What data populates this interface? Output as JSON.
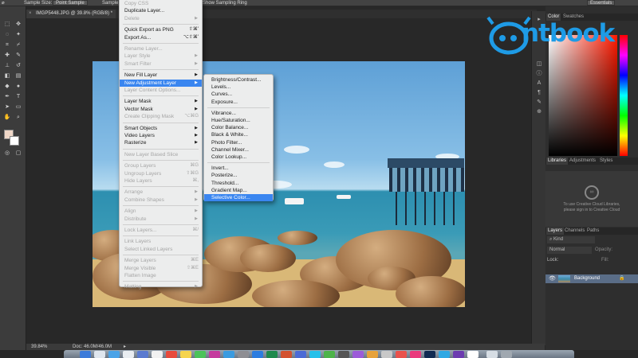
{
  "options_bar": {
    "sample_size_label": "Sample Size:",
    "sample_size_value": "Point Sample",
    "sample_label": "Sample",
    "show_ring_label": "Show Sampling Ring",
    "workspace": "Essentials"
  },
  "document": {
    "tab_title": "IMGP5448.JPG @ 39.8% (RGB/8) *"
  },
  "layer_menu": {
    "items": [
      {
        "label": "Copy CSS",
        "shortcut": "",
        "submenu": false,
        "disabled": true
      },
      {
        "label": "Duplicate Layer...",
        "shortcut": "",
        "submenu": false,
        "disabled": false
      },
      {
        "label": "Delete",
        "shortcut": "",
        "submenu": true,
        "disabled": true
      },
      {
        "label": "Quick Export as PNG",
        "shortcut": "⇧⌘'",
        "submenu": false,
        "disabled": false
      },
      {
        "label": "Export As...",
        "shortcut": "⌥⇧⌘'",
        "submenu": false,
        "disabled": false
      },
      {
        "label": "Rename Layer...",
        "shortcut": "",
        "submenu": false,
        "disabled": true
      },
      {
        "label": "Layer Style",
        "shortcut": "",
        "submenu": true,
        "disabled": true
      },
      {
        "label": "Smart Filter",
        "shortcut": "",
        "submenu": true,
        "disabled": true
      },
      {
        "label": "New Fill Layer",
        "shortcut": "",
        "submenu": true,
        "disabled": false
      },
      {
        "label": "New Adjustment Layer",
        "shortcut": "",
        "submenu": true,
        "disabled": false
      },
      {
        "label": "Layer Content Options...",
        "shortcut": "",
        "submenu": false,
        "disabled": true
      },
      {
        "label": "Layer Mask",
        "shortcut": "",
        "submenu": true,
        "disabled": false
      },
      {
        "label": "Vector Mask",
        "shortcut": "",
        "submenu": true,
        "disabled": false
      },
      {
        "label": "Create Clipping Mask",
        "shortcut": "⌥⌘G",
        "submenu": false,
        "disabled": true
      },
      {
        "label": "Smart Objects",
        "shortcut": "",
        "submenu": true,
        "disabled": false
      },
      {
        "label": "Video Layers",
        "shortcut": "",
        "submenu": true,
        "disabled": false
      },
      {
        "label": "Rasterize",
        "shortcut": "",
        "submenu": true,
        "disabled": false
      },
      {
        "label": "New Layer Based Slice",
        "shortcut": "",
        "submenu": false,
        "disabled": true
      },
      {
        "label": "Group Layers",
        "shortcut": "⌘G",
        "submenu": false,
        "disabled": true
      },
      {
        "label": "Ungroup Layers",
        "shortcut": "⇧⌘G",
        "submenu": false,
        "disabled": true
      },
      {
        "label": "Hide Layers",
        "shortcut": "⌘,",
        "submenu": false,
        "disabled": true
      },
      {
        "label": "Arrange",
        "shortcut": "",
        "submenu": true,
        "disabled": true
      },
      {
        "label": "Combine Shapes",
        "shortcut": "",
        "submenu": true,
        "disabled": true
      },
      {
        "label": "Align",
        "shortcut": "",
        "submenu": true,
        "disabled": true
      },
      {
        "label": "Distribute",
        "shortcut": "",
        "submenu": true,
        "disabled": true
      },
      {
        "label": "Lock Layers...",
        "shortcut": "⌘/",
        "submenu": false,
        "disabled": true
      },
      {
        "label": "Link Layers",
        "shortcut": "",
        "submenu": false,
        "disabled": true
      },
      {
        "label": "Select Linked Layers",
        "shortcut": "",
        "submenu": false,
        "disabled": true
      },
      {
        "label": "Merge Layers",
        "shortcut": "⌘E",
        "submenu": false,
        "disabled": true
      },
      {
        "label": "Merge Visible",
        "shortcut": "⇧⌘E",
        "submenu": false,
        "disabled": true
      },
      {
        "label": "Flatten Image",
        "shortcut": "",
        "submenu": false,
        "disabled": true
      },
      {
        "label": "Matting",
        "shortcut": "",
        "submenu": true,
        "disabled": true
      }
    ]
  },
  "adjustment_submenu": {
    "items": [
      "Brightness/Contrast...",
      "Levels...",
      "Curves...",
      "Exposure...",
      "Vibrance...",
      "Hue/Saturation...",
      "Color Balance...",
      "Black & White...",
      "Photo Filter...",
      "Channel Mixer...",
      "Color Lookup...",
      "Invert...",
      "Posterize...",
      "Threshold...",
      "Gradient Map...",
      "Selective Color..."
    ],
    "highlighted": "Selective Color..."
  },
  "panels": {
    "color_tabs": [
      "Color",
      "Swatches"
    ],
    "library_tabs": [
      "Libraries",
      "Adjustments",
      "Styles"
    ],
    "library_message_1": "To use Creative Cloud Libraries,",
    "library_message_2": "please sign in to Creative Cloud",
    "layers_tabs": [
      "Layers",
      "Channels",
      "Paths"
    ],
    "kind_label": "Kind",
    "blend_mode": "Normal",
    "opacity_label": "Opacity:",
    "lock_label": "Lock:",
    "fill_label": "Fill:",
    "layer_name": "Background"
  },
  "status_bar": {
    "zoom": "39.84%",
    "doc_size": "Doc: 46.0M/46.0M"
  },
  "watermark": {
    "text": "ntbook"
  },
  "colors": {
    "highlight": "#3a86f0",
    "watermark": "#1e9be6",
    "layer_selected": "#5a6d87"
  }
}
